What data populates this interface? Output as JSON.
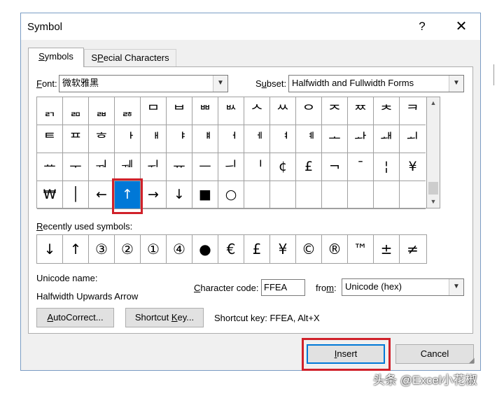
{
  "window": {
    "title": "Symbol",
    "help_glyph": "?",
    "close_glyph": "✕"
  },
  "tabs": [
    {
      "label": "Symbols",
      "mnemonic": "S",
      "rest": "ymbols"
    },
    {
      "label": "Special Characters",
      "mnemonic": "P",
      "pre": "S",
      "rest": "ecial Characters"
    }
  ],
  "font": {
    "label_mnemonic": "F",
    "label_rest": "ont:",
    "value": "微软雅黑"
  },
  "subset": {
    "label_pre": "S",
    "label_mnemonic": "u",
    "label_rest": "bset:",
    "value": "Halfwidth and Fullwidth Forms"
  },
  "symbol_grid": {
    "rows": [
      [
        "ᆰ",
        "ᆱ",
        "ᆲ",
        "ᆶ",
        "ᄆ",
        "ᄇ",
        "ᄈ",
        "ᄡ",
        "ᄉ",
        "ᄊ",
        "ᄋ",
        "ᄌ",
        "ᄍ",
        "ᄎ",
        "ᄏ"
      ],
      [
        "ᄐ",
        "ᄑ",
        "ᄒ",
        "ᅡ",
        "ᅢ",
        "ᅣ",
        "ᅤ",
        "ᅥ",
        "ᅦ",
        "ᅧ",
        "ᅨ",
        "ᅩ",
        "ᅪ",
        "ᅫ",
        "ᅬ"
      ],
      [
        "ᅭ",
        "ᅮ",
        "ᅯ",
        "ᅰ",
        "ᅱ",
        "ᅲ",
        "ᅳ",
        "ᅴ",
        "ᅵ",
        "¢",
        "£",
        "¬",
        "¯",
        "¦",
        "¥"
      ],
      [
        "₩",
        "│",
        "←",
        "↑",
        "→",
        "↓",
        "■",
        "○",
        "",
        "",
        "",
        "",
        "",
        "",
        ""
      ]
    ],
    "selected": "↑"
  },
  "recently_used": {
    "label_mnemonic": "R",
    "label_rest": "ecently used symbols:",
    "symbols": [
      "↓",
      "↑",
      "③",
      "②",
      "①",
      "④",
      "●",
      "€",
      "£",
      "¥",
      "©",
      "®",
      "™",
      "±",
      "≠"
    ]
  },
  "unicode_name": {
    "label": "Unicode name:",
    "value": "Halfwidth Upwards Arrow"
  },
  "character_code": {
    "label_mnemonic": "C",
    "label_rest": "haracter code:",
    "value": "FFEA"
  },
  "from": {
    "label_pre": "fro",
    "label_mnemonic": "m",
    "label_rest": ":",
    "value": "Unicode (hex)"
  },
  "buttons": {
    "autocorrect": {
      "pre": "",
      "mnemonic": "A",
      "rest": "utoCorrect..."
    },
    "shortcut_key": {
      "pre": "Shortcut ",
      "mnemonic": "K",
      "rest": "ey..."
    },
    "insert": {
      "pre": "",
      "mnemonic": "I",
      "rest": "nsert"
    },
    "cancel": "Cancel"
  },
  "shortcut_text": "Shortcut key: FFEA, Alt+X",
  "watermark": "头条 @Excel小花椒",
  "colors": {
    "selection": "#0078d7",
    "highlight_box": "#d0212a"
  }
}
